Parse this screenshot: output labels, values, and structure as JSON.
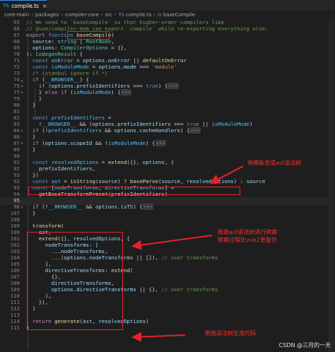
{
  "tab": {
    "icon": "TS",
    "label": "compile.ts",
    "close": "×"
  },
  "breadcrumb": {
    "items": [
      "core-main",
      "packages",
      "compiler-core",
      "src"
    ],
    "file_icon": "TS",
    "file": "compile.ts",
    "symbol_icon": "⊙",
    "symbol": "baseCompile"
  },
  "annotations": {
    "a1": "将模板变成ast语法树",
    "a2_line1": "根据ast语法树进行转换",
    "a2_line2": "转换过程比vue2更复杂",
    "a3": "根据语法树生成代码"
  },
  "watermark": "CSDN @三月的一天",
  "colors": {
    "annotation": "#e8212d",
    "background": "#1e1e1e"
  }
}
